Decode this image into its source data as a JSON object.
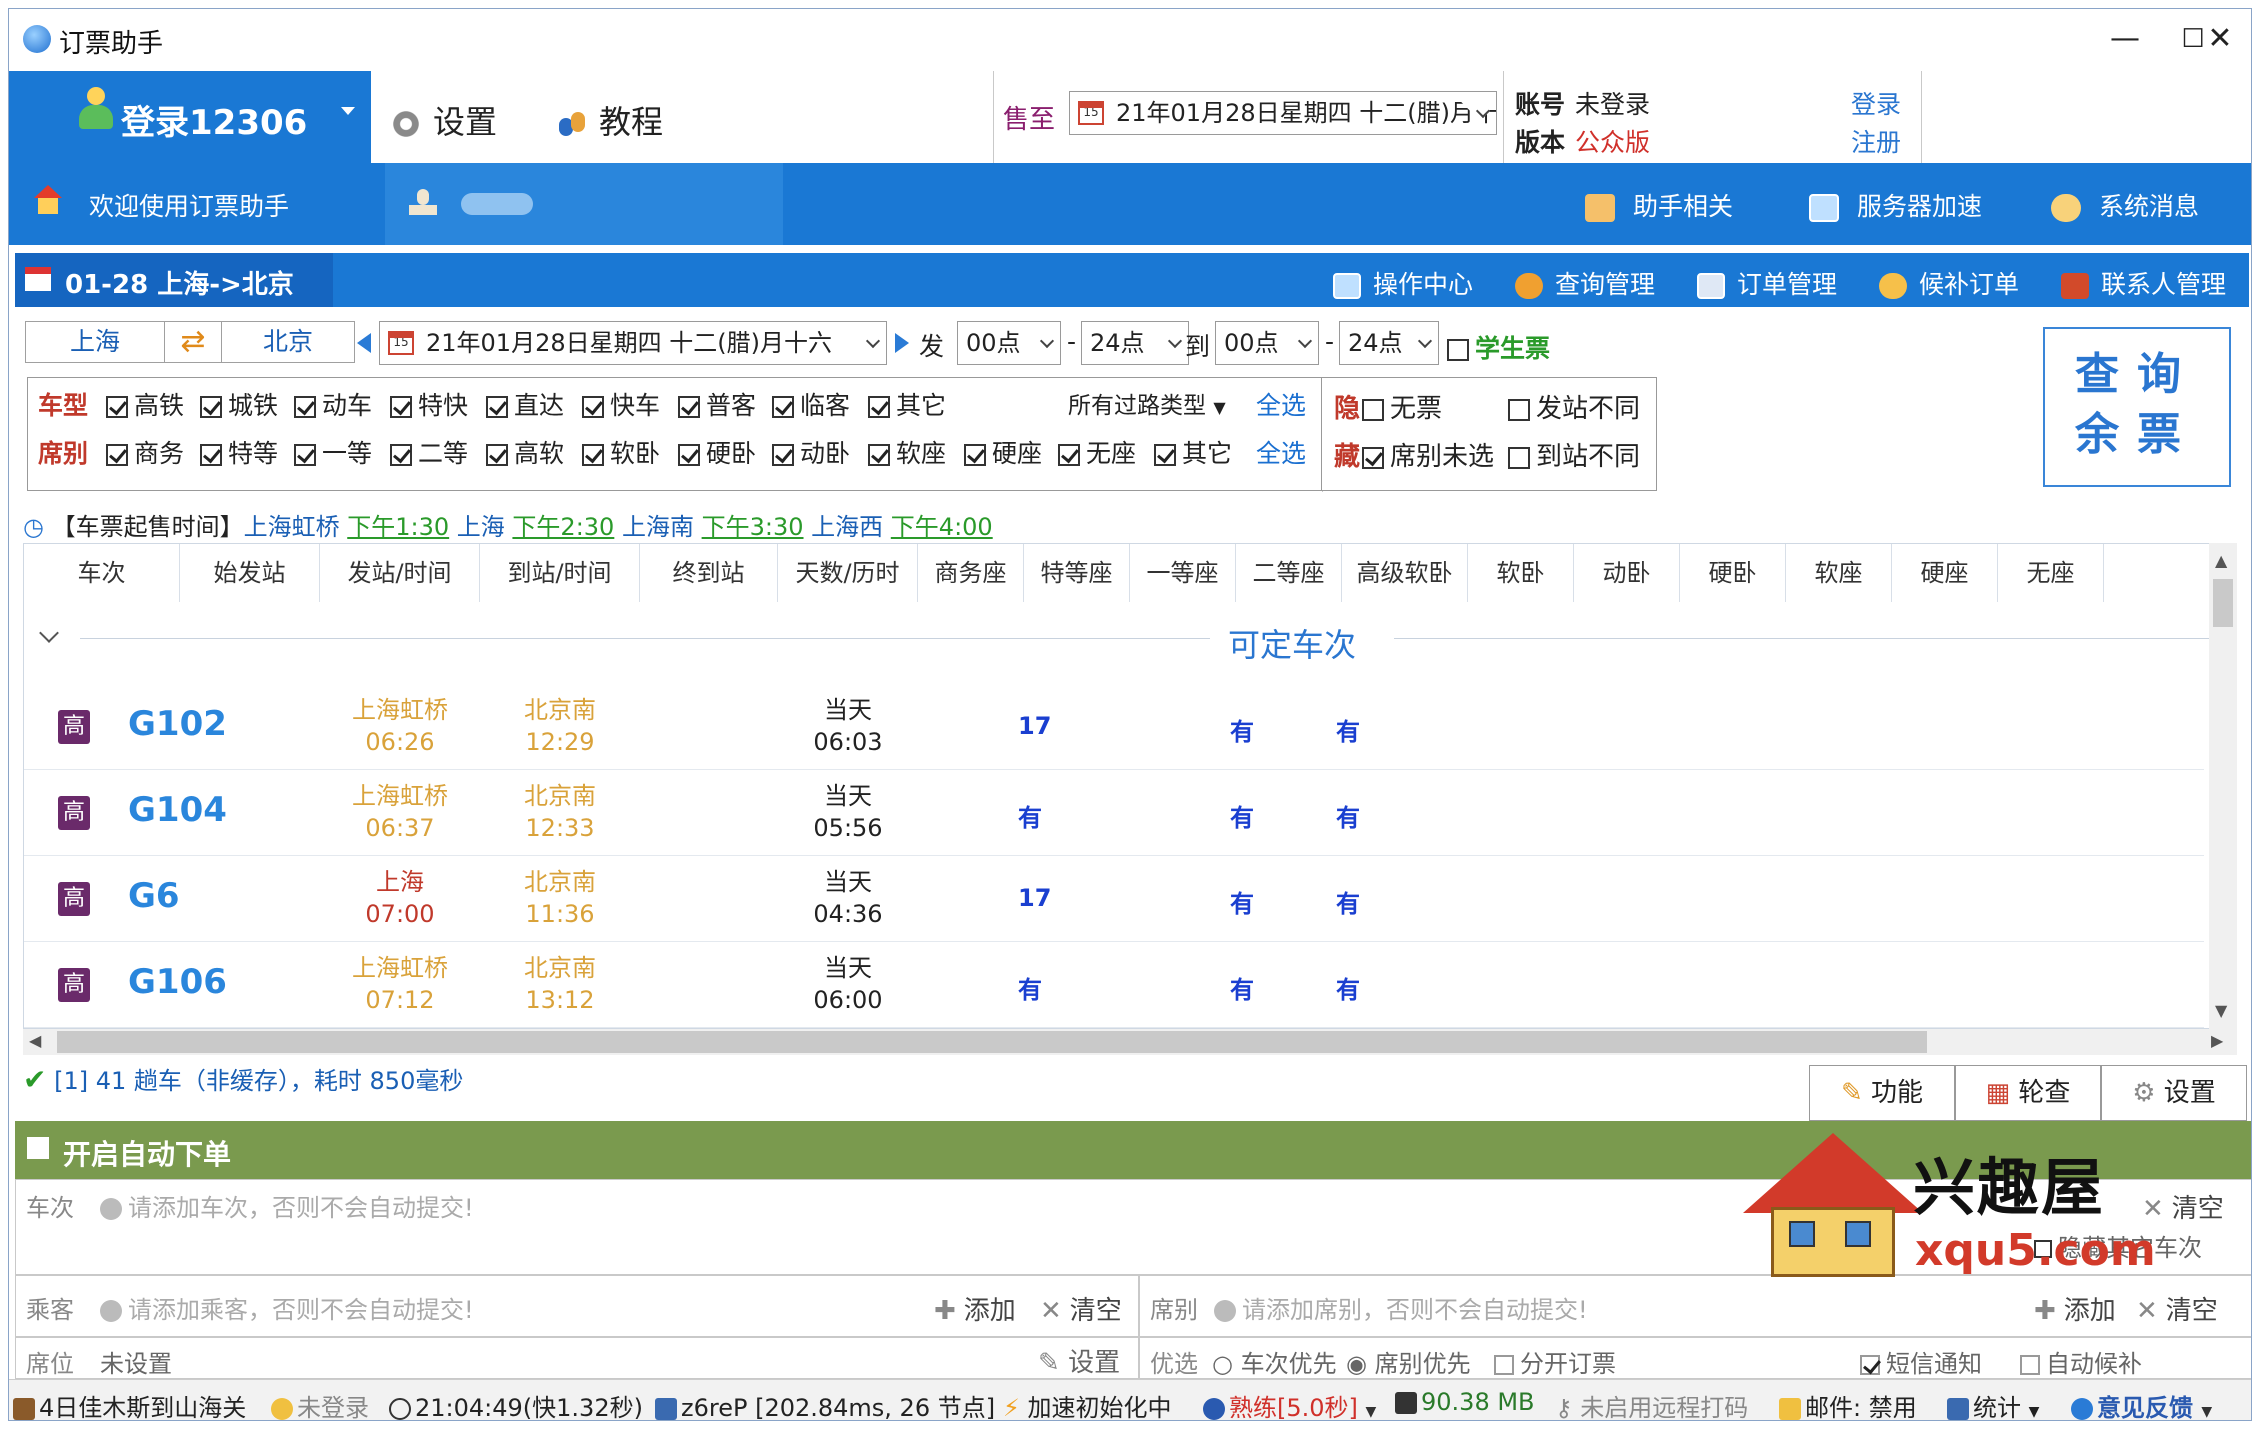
{
  "window": {
    "title": "订票助手",
    "min": "—",
    "max": "☐",
    "close": "✕"
  },
  "header": {
    "login_label": "登录12306",
    "settings_label": "设置",
    "tutorial_label": "教程",
    "sale_label": "售至",
    "sale_date": "21年01月28日星期四 十二(腊)月十六",
    "account_label": "账号",
    "account_value": "未登录",
    "version_label": "版本",
    "version_value": "公众版",
    "login_link": "登录",
    "register_link": "注册"
  },
  "bluebar": {
    "welcome": "欢迎使用订票助手",
    "items": [
      "助手相关",
      "服务器加速",
      "系统消息"
    ]
  },
  "routebar": {
    "tab": "01-28 上海->北京",
    "items": [
      "操作中心",
      "查询管理",
      "订单管理",
      "候补订单",
      "联系人管理"
    ]
  },
  "query": {
    "from": "上海",
    "to": "北京",
    "date": "21年01月28日星期四 十二(腊)月十六",
    "depart_label": "发",
    "depart_start": "00点",
    "depart_end": "24点",
    "arrive_label": "到",
    "arrive_start": "00点",
    "arrive_end": "24点",
    "dash": "-",
    "student_label": "学生票",
    "query_btn_line1": "查询",
    "query_btn_line2": "余票"
  },
  "filters": {
    "type_head": "车型",
    "types": [
      "高铁",
      "城铁",
      "动车",
      "特快",
      "直达",
      "快车",
      "普客",
      "临客",
      "其它"
    ],
    "route_type": "所有过路类型",
    "select_all": "全选",
    "seat_head": "席别",
    "seats": [
      "商务",
      "特等",
      "一等",
      "二等",
      "高软",
      "软卧",
      "硬卧",
      "动卧",
      "软座",
      "硬座",
      "无座",
      "其它"
    ],
    "hide_head1": "隐",
    "hide_head2": "藏",
    "no_ticket": "无票",
    "diff_from": "发站不同",
    "seat_unselected": "席别未选",
    "diff_to": "到站不同"
  },
  "sale_time": {
    "prefix": "【车票起售时间】",
    "entries": [
      {
        "station": "上海虹桥",
        "time": "下午1:30"
      },
      {
        "station": "上海",
        "time": "下午2:30"
      },
      {
        "station": "上海南",
        "time": "下午3:30"
      },
      {
        "station": "上海西",
        "time": "下午4:00"
      }
    ]
  },
  "table": {
    "headers": [
      "车次",
      "始发站",
      "发站/时间",
      "到站/时间",
      "终到站",
      "天数/历时",
      "商务座",
      "特等座",
      "一等座",
      "二等座",
      "高级软卧",
      "软卧",
      "动卧",
      "硬卧",
      "软座",
      "硬座",
      "无座"
    ],
    "group_title": "可定车次",
    "rows": [
      {
        "badge": "高",
        "train": "G102",
        "from": "上海虹桥",
        "dep": "06:26",
        "to": "北京南",
        "arr": "12:29",
        "day": "当天",
        "dur": "06:03",
        "business": "17",
        "first": "有",
        "second": "有",
        "from_color": "#d9a23a"
      },
      {
        "badge": "高",
        "train": "G104",
        "from": "上海虹桥",
        "dep": "06:37",
        "to": "北京南",
        "arr": "12:33",
        "day": "当天",
        "dur": "05:56",
        "business": "有",
        "first": "有",
        "second": "有",
        "from_color": "#d9a23a"
      },
      {
        "badge": "高",
        "train": "G6",
        "from": "上海",
        "dep": "07:00",
        "to": "北京南",
        "arr": "11:36",
        "day": "当天",
        "dur": "04:36",
        "business": "17",
        "first": "有",
        "second": "有",
        "from_color": "#c0392b"
      },
      {
        "badge": "高",
        "train": "G106",
        "from": "上海虹桥",
        "dep": "07:12",
        "to": "北京南",
        "arr": "13:12",
        "day": "当天",
        "dur": "06:00",
        "business": "有",
        "first": "有",
        "second": "有",
        "from_color": "#d9a23a"
      }
    ]
  },
  "status": {
    "message": "[1] 41 趟车（非缓存），耗时 850毫秒",
    "tabs": [
      "功能",
      "轮查",
      "设置"
    ]
  },
  "auto_order": {
    "title": "开启自动下单",
    "train_label": "车次",
    "train_hint": "请添加车次，否则不会自动提交!",
    "clear": "清空",
    "hide_other": "隐藏其它车次",
    "passenger_label": "乘客",
    "passenger_hint": "请添加乘客，否则不会自动提交!",
    "add": "添加",
    "seat_label": "席别",
    "seat_hint": "请添加席别，否则不会自动提交!",
    "position_label": "席位",
    "position_value": "未设置",
    "settings": "设置",
    "priority_label": "优选",
    "train_first": "车次优先",
    "seat_first": "席别优先",
    "split": "分开订票",
    "sms": "短信通知",
    "auto_wait": "自动候补"
  },
  "watermark": {
    "name": "兴趣屋",
    "url": "xqu5.com"
  },
  "statusbar": {
    "news": "4日佳木斯到山海关",
    "login": "未登录",
    "clock": "21:04:49(快1.32秒)",
    "server": "z6reP [202.84ms, 26 节点]",
    "accel": "加速初始化中",
    "mode": "熟练[5.0秒]",
    "memory": "90.38 MB",
    "remote": "未启用远程打码",
    "mail": "邮件: 禁用",
    "stats": "统计",
    "feedback": "意见反馈"
  }
}
